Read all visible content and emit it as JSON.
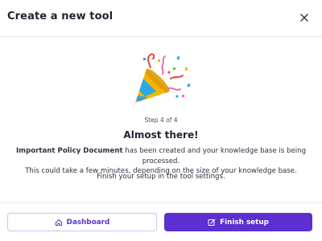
{
  "dialog": {
    "title": "Create a new tool",
    "close_icon": "close-icon"
  },
  "illustration": {
    "icon": "party-popper-icon"
  },
  "content": {
    "step": "Step 4 of 4",
    "heading": "Almost there!",
    "doc_name": "Important Policy Document",
    "message_after_name": " has been created and your knowledge base is being processed.",
    "message_line2": "This could take a few minutes, depending on the size of your knowledge base.",
    "finish_text": "Finish your setup in the tool settings."
  },
  "footer": {
    "dashboard_label": "Dashboard",
    "dashboard_icon": "home-icon",
    "finish_label": "Finish setup",
    "finish_icon": "edit-icon"
  },
  "colors": {
    "accent": "#5b2fd0",
    "accent_text": "#5b33c9"
  }
}
